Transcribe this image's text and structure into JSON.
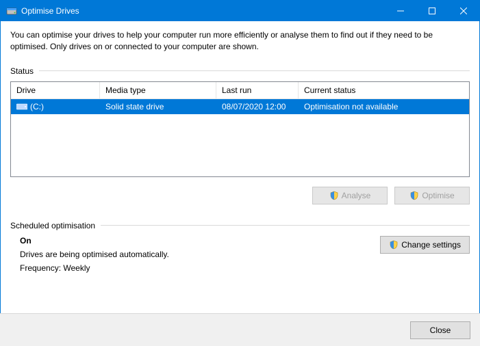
{
  "window": {
    "title": "Optimise Drives"
  },
  "intro": "You can optimise your drives to help your computer run more efficiently or analyse them to find out if they need to be optimised. Only drives on or connected to your computer are shown.",
  "status_section_label": "Status",
  "table": {
    "headers": {
      "drive": "Drive",
      "media": "Media type",
      "last": "Last run",
      "status": "Current status"
    },
    "rows": [
      {
        "drive": "(C:)",
        "media": "Solid state drive",
        "last": "08/07/2020 12:00",
        "status": "Optimisation not available"
      }
    ]
  },
  "actions": {
    "analyse": "Analyse",
    "optimise": "Optimise"
  },
  "scheduled_section_label": "Scheduled optimisation",
  "scheduled": {
    "status": "On",
    "desc": "Drives are being optimised automatically.",
    "frequency_label": "Frequency: Weekly",
    "change_settings": "Change settings"
  },
  "footer": {
    "close": "Close"
  }
}
